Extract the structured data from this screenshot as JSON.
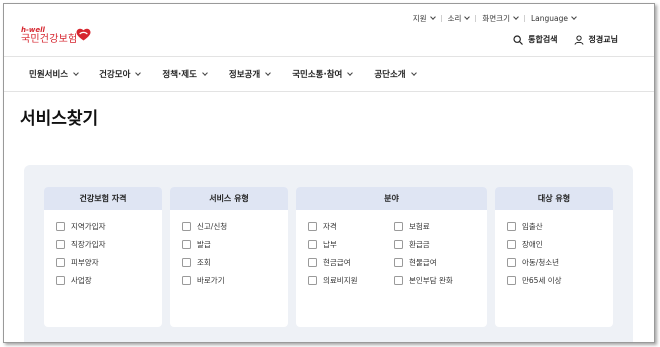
{
  "util_bar": {
    "items": [
      {
        "label": "지원"
      },
      {
        "label": "소리"
      },
      {
        "label": "화면크기"
      },
      {
        "label": "Language"
      }
    ]
  },
  "logo": {
    "tagline": "h-well",
    "name": "국민건강보험"
  },
  "actions": {
    "search_label": "통합검색",
    "user_label": "정경교님"
  },
  "nav": {
    "items": [
      {
        "label": "민원서비스"
      },
      {
        "label": "건강모아"
      },
      {
        "label": "정책·제도"
      },
      {
        "label": "정보공개"
      },
      {
        "label": "국민소통·참여"
      },
      {
        "label": "공단소개"
      }
    ]
  },
  "page": {
    "title": "서비스찾기"
  },
  "filters": {
    "qualification": {
      "title": "건강보험 자격",
      "options": [
        "지역가입자",
        "직장가입자",
        "피부양자",
        "사업장"
      ]
    },
    "service_type": {
      "title": "서비스 유형",
      "options": [
        "신고/신청",
        "발급",
        "조회",
        "바로가기"
      ]
    },
    "field": {
      "title": "분야",
      "options": [
        "자격",
        "보험료",
        "납부",
        "환급금",
        "현금급여",
        "현물급여",
        "의료비지원",
        "본인부담 완화"
      ]
    },
    "target_type": {
      "title": "대상 유형",
      "options": [
        "임출산",
        "장애인",
        "아동/청소년",
        "만65세 이상"
      ]
    }
  },
  "colors": {
    "brand_red": "#d6262f",
    "panel_header": "#dfe5f3",
    "filter_background": "#eef1f6"
  }
}
